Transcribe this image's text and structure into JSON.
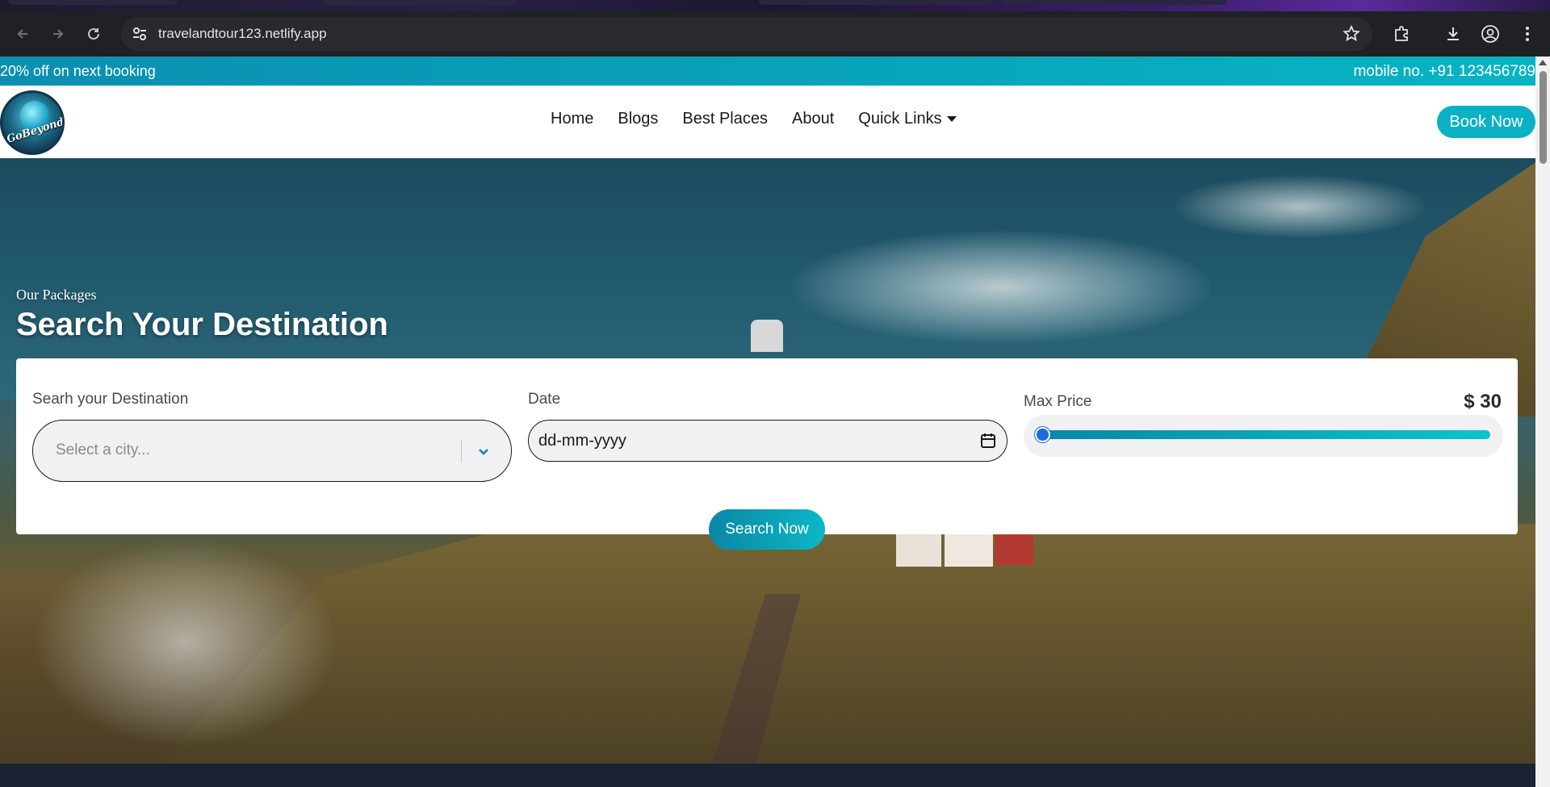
{
  "browser": {
    "url": "travelandtour123.netlify.app"
  },
  "promo": {
    "offer": "20% off on next booking",
    "contact": "mobile no. +91 123456789"
  },
  "navbar": {
    "logo_text": "GoBeyond",
    "links": [
      "Home",
      "Blogs",
      "Best Places",
      "About",
      "Quick Links"
    ],
    "book_label": "Book Now"
  },
  "hero": {
    "subtitle": "Our Packages",
    "title": "Search Your Destination"
  },
  "search": {
    "destination_label": "Searh your Destination",
    "destination_placeholder": "Select a city...",
    "date_label": "Date",
    "date_placeholder": "dd-mm-yyyy",
    "price_label": "Max Price",
    "price_value": "$ 30",
    "price_level": 0.0,
    "button_label": "Search Now"
  },
  "colors": {
    "accent": "#0bb1c4",
    "promo_start": "#0a8fb0",
    "slider_thumb": "#1a6dd8"
  }
}
